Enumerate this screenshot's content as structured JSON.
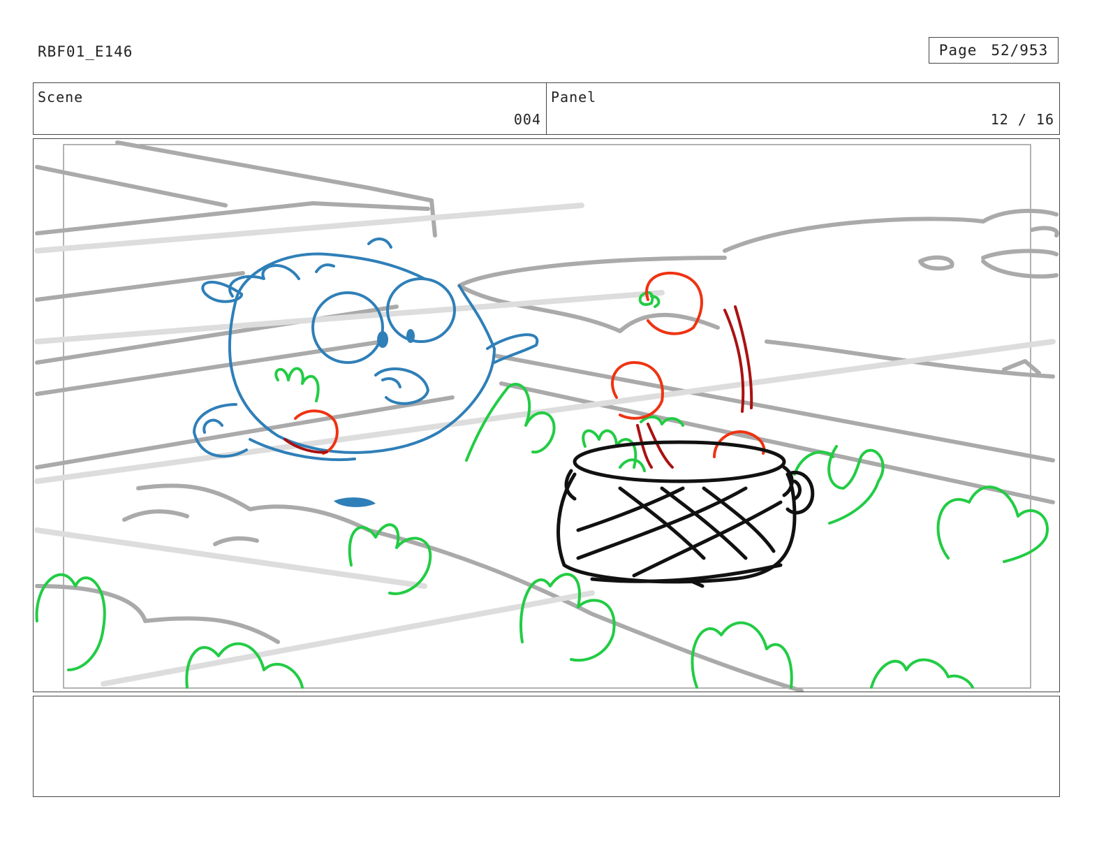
{
  "header": {
    "doc_id": "RBF01_E146",
    "page_label": "Page",
    "page_value": "52/953"
  },
  "info": {
    "scene_label": "Scene",
    "scene_value": "004",
    "panel_label": "Panel",
    "panel_value": "12 / 16"
  },
  "notes": {
    "text": ""
  },
  "colors": {
    "background_lines": "#aaaaaa",
    "character": "#2f7fb8",
    "grass": "#22cc44",
    "tomato": "#ee3311",
    "motion_lines": "#aa1111",
    "basket": "#111111"
  }
}
